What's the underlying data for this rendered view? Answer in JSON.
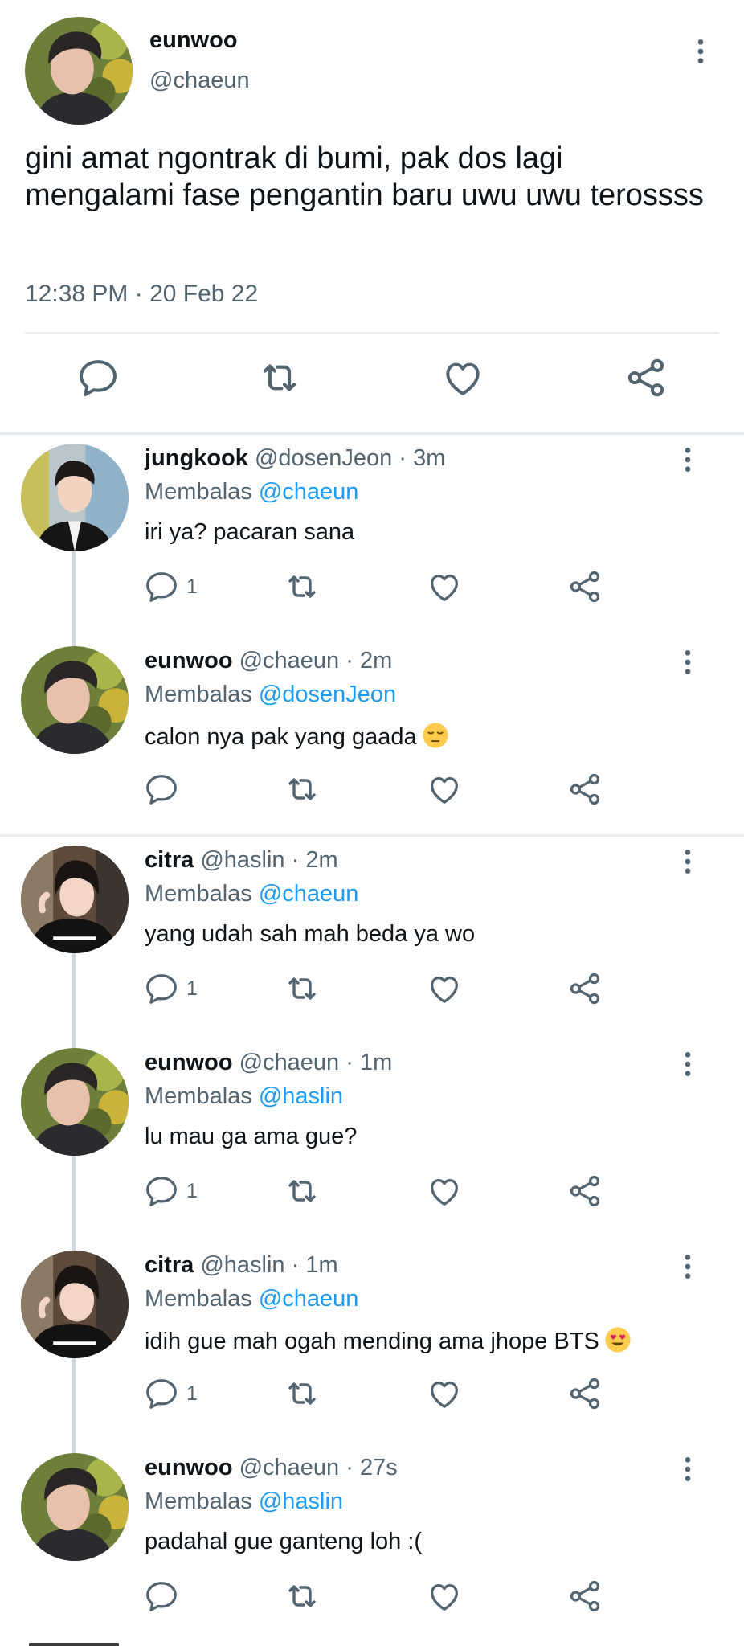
{
  "main_tweet": {
    "name": "eunwoo",
    "handle": "@chaeun",
    "text": "gini amat ngontrak di bumi, pak dos lagi mengalami fase pengantin baru uwu uwu terossss",
    "timestamp": "12:38 PM · 20 Feb 22",
    "actions": [
      "reply-icon",
      "retweet-icon",
      "like-icon",
      "share-icon"
    ]
  },
  "replies": [
    {
      "name": "jungkook",
      "handle": "@dosenJeon",
      "time": "3m",
      "replying_label": "Membalas",
      "replying_to": "@chaeun",
      "text": "iri ya? pacaran sana",
      "reply_count": "1",
      "emoji": ""
    },
    {
      "name": "eunwoo",
      "handle": "@chaeun",
      "time": "2m",
      "replying_label": "Membalas",
      "replying_to": "@dosenJeon",
      "text": "calon nya pak yang gaada",
      "reply_count": "",
      "emoji": "pensive-face"
    },
    {
      "name": "citra",
      "handle": "@haslin",
      "time": "2m",
      "replying_label": "Membalas",
      "replying_to": "@chaeun",
      "text": "yang udah sah mah beda ya wo",
      "reply_count": "1",
      "emoji": ""
    },
    {
      "name": "eunwoo",
      "handle": "@chaeun",
      "time": "1m",
      "replying_label": "Membalas",
      "replying_to": "@haslin",
      "text": "lu mau ga ama gue?",
      "reply_count": "1",
      "emoji": ""
    },
    {
      "name": "citra",
      "handle": "@haslin",
      "time": "1m",
      "replying_label": "Membalas",
      "replying_to": "@chaeun",
      "text": "idih gue mah ogah mending ama jhope BTS",
      "reply_count": "1",
      "emoji": "heart-eyes-face"
    },
    {
      "name": "eunwoo",
      "handle": "@chaeun",
      "time": "27s",
      "replying_label": "Membalas",
      "replying_to": "@haslin",
      "text": "padahal gue ganteng loh :(",
      "reply_count": "",
      "emoji": ""
    }
  ],
  "colors": {
    "text": "#0f1419",
    "secondary": "#536471",
    "accent": "#1d9bf0",
    "divider": "#e6ecf0",
    "thread_line": "#cfd9de"
  }
}
